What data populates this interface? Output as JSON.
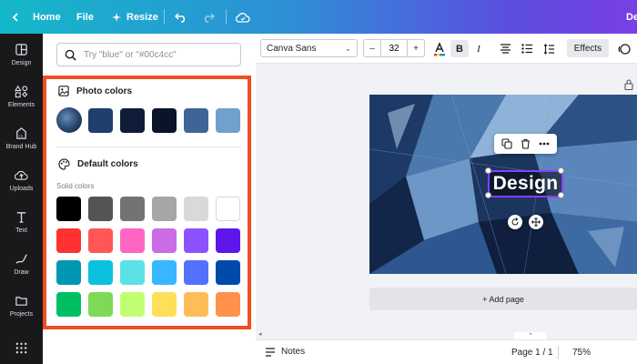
{
  "topbar": {
    "home_label": "Home",
    "file_label": "File",
    "resize_label": "Resize",
    "user_label": "De"
  },
  "sidenav": {
    "items": [
      {
        "label": "Design",
        "icon": "layout-icon"
      },
      {
        "label": "Elements",
        "icon": "shapes-icon"
      },
      {
        "label": "Brand Hub",
        "icon": "brand-icon"
      },
      {
        "label": "Uploads",
        "icon": "upload-icon"
      },
      {
        "label": "Text",
        "icon": "text-icon"
      },
      {
        "label": "Draw",
        "icon": "draw-icon"
      },
      {
        "label": "Projects",
        "icon": "folder-icon"
      },
      {
        "label": "",
        "icon": "apps-icon"
      }
    ]
  },
  "panel": {
    "search_placeholder": "Try \"blue\" or \"#00c4cc\"",
    "photo_colors_title": "Photo colors",
    "photo_colors": [
      "#1f3f6d",
      "#0f1d38",
      "#0a1428",
      "#3e6596",
      "#72a0cc"
    ],
    "default_colors_title": "Default colors",
    "solid_colors_label": "Solid colors",
    "solid_colors": [
      [
        "#000000",
        "#545454",
        "#737373",
        "#a6a6a6",
        "#d9d9d9",
        "#ffffff"
      ],
      [
        "#ff3131",
        "#ff5757",
        "#ff66c4",
        "#cb6ce6",
        "#8c52ff",
        "#5e17eb"
      ],
      [
        "#0097b2",
        "#0cc0df",
        "#5ce1e6",
        "#38b6ff",
        "#5271ff",
        "#004aad"
      ],
      [
        "#00bf63",
        "#7ed957",
        "#c1ff72",
        "#ffde59",
        "#ffbd59",
        "#ff914d"
      ]
    ],
    "highlight_color": "#f04e23"
  },
  "toolbar": {
    "font_name": "Canva Sans",
    "font_size": "32",
    "minus": "–",
    "plus": "+",
    "effects_label": "Effects"
  },
  "canvas": {
    "design_text": "Design",
    "add_page_label": "+ Add page",
    "selection_color": "#8b3dff"
  },
  "bottombar": {
    "notes_label": "Notes",
    "page_indicator": "Page 1 / 1",
    "zoom_label": "75%"
  }
}
